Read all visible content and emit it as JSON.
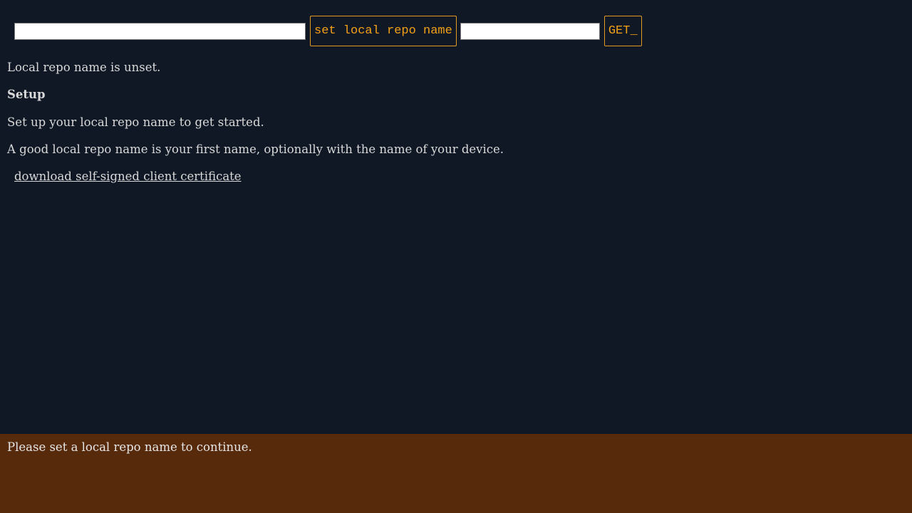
{
  "toolbar": {
    "name_input_value": "",
    "set_button_label": "set local repo name",
    "get_input_value": "",
    "get_button_label": "GET_"
  },
  "status": {
    "repo_name_status": "Local repo name is unset."
  },
  "setup": {
    "heading": "Setup",
    "intro": "Set up your local repo name to get started.",
    "hint": "A good local repo name is your first name, optionally with the name of your device.",
    "cert_link": "download self-signed client certificate"
  },
  "footer": {
    "message": "Please set a local repo name to continue."
  },
  "colors": {
    "background": "#101826",
    "accent": "#f3a116",
    "status_bar": "#572a0c"
  }
}
